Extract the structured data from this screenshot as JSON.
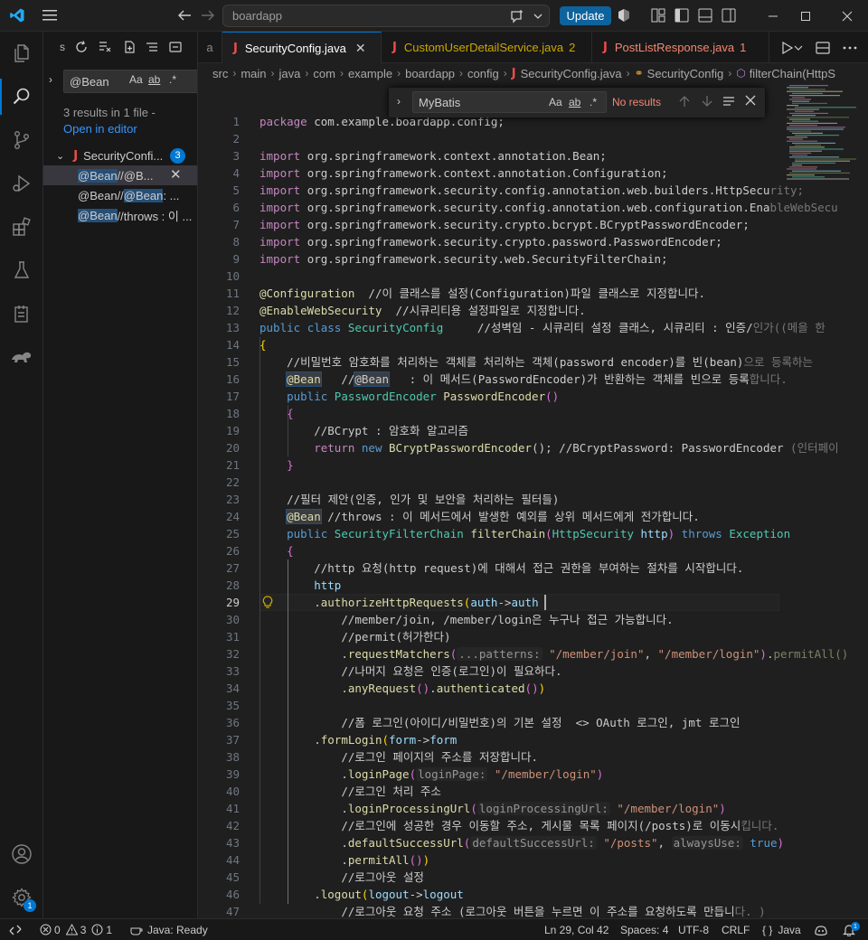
{
  "titlebar": {
    "command_center": "boardapp",
    "update_label": "Update"
  },
  "activity": {
    "settings_badge": "1"
  },
  "sidebar": {
    "title_letter": "s",
    "search_value": "@Bean",
    "search_options": [
      "Aa",
      "ab",
      ".*"
    ],
    "results_message": "3 results in 1 file -",
    "open_in_editor": "Open in editor",
    "file_name": "SecurityConfi...",
    "file_match_count": "3",
    "matches": [
      {
        "highlight": "@Bean",
        "rest": "  //@B..."
      },
      {
        "prefix": "",
        "highlight": "@Bean",
        "mid": "  //",
        "highlight2": "@Bean",
        "rest": "  : ..."
      },
      {
        "highlight": "@Bean",
        "rest": " //throws : 이 ..."
      }
    ]
  },
  "tabs": [
    {
      "label": "a",
      "status": ""
    },
    {
      "label": "SecurityConfig.java",
      "status": "close"
    },
    {
      "label": "CustomUserDetailService.java",
      "status": "2"
    },
    {
      "label": "PostListResponse.java",
      "status": "1"
    }
  ],
  "breadcrumb": [
    "src",
    "main",
    "java",
    "com",
    "example",
    "boardapp",
    "config",
    "SecurityConfig.java",
    "SecurityConfig",
    "filterChain(HttpS"
  ],
  "find": {
    "value": "MyBatis",
    "options": [
      "Aa",
      "ab",
      ".*"
    ],
    "result": "No results"
  },
  "editor": {
    "current_line": 29,
    "line_numbers": [
      "1",
      "2",
      "3",
      "4",
      "5",
      "6",
      "7",
      "8",
      "9",
      "10",
      "11",
      "12",
      "13",
      "14",
      "15",
      "16",
      "17",
      "18",
      "19",
      "20",
      "21",
      "22",
      "23",
      "24",
      "25",
      "26",
      "27",
      "28",
      "29",
      "30",
      "31",
      "32",
      "33",
      "34",
      "35",
      "36",
      "37",
      "38",
      "39",
      "40",
      "41",
      "42",
      "43",
      "44",
      "45",
      "46",
      "47"
    ]
  },
  "statusbar": {
    "errors": "0",
    "warnings": "3",
    "infos": "1",
    "java_status": "Java: Ready",
    "position": "Ln 29, Col 42",
    "spaces": "Spaces: 4",
    "encoding": "UTF-8",
    "eol": "CRLF",
    "language": "Java",
    "bell_badge": "1"
  },
  "colors": {
    "accent": "#0078d4",
    "update_button": "#0e639c",
    "java_icon": "#f14c4c"
  }
}
